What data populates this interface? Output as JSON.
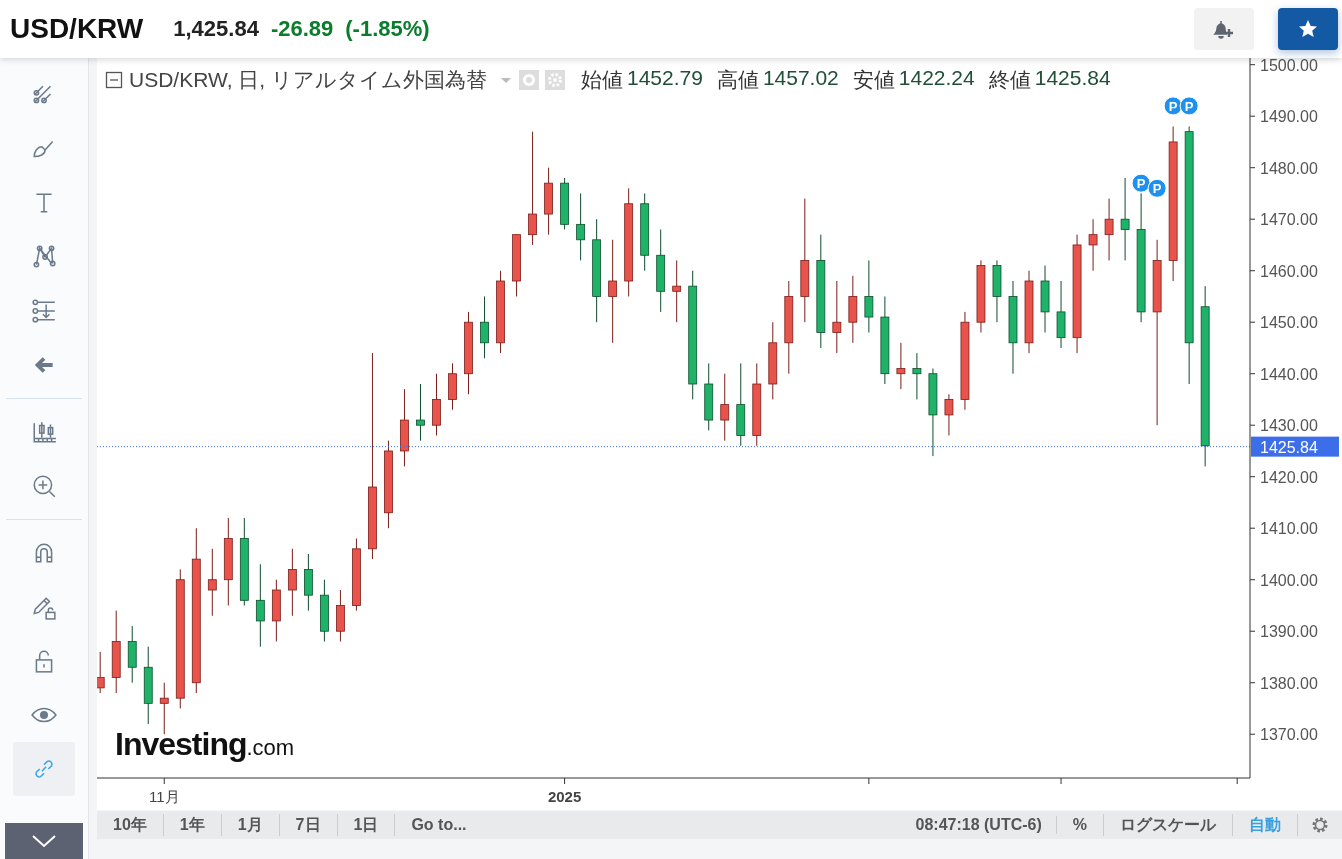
{
  "header": {
    "symbol": "USD/KRW",
    "price": "1,425.84",
    "change": "-26.89",
    "change_percent": "(-1.85%)",
    "favorite": true
  },
  "legend": {
    "title": "USD/KRW, 日, リアルタイム外国為替",
    "ohlc": [
      {
        "label": "始値",
        "value": "1452.79"
      },
      {
        "label": "高値",
        "value": "1457.02"
      },
      {
        "label": "安値",
        "value": "1422.24"
      },
      {
        "label": "終値",
        "value": "1425.84"
      }
    ]
  },
  "toolbar": [
    {
      "kind": "lines"
    },
    {
      "kind": "brush"
    },
    {
      "kind": "text"
    },
    {
      "kind": "pattern"
    },
    {
      "kind": "measure"
    },
    {
      "kind": "back"
    },
    {
      "kind": "divider"
    },
    {
      "kind": "candles"
    },
    {
      "kind": "zoom"
    },
    {
      "kind": "divider"
    },
    {
      "kind": "magnet"
    },
    {
      "kind": "pencil-lock"
    },
    {
      "kind": "lock"
    },
    {
      "kind": "eye"
    },
    {
      "kind": "link",
      "selected": true
    }
  ],
  "chart": {
    "watermark_main": "Investing",
    "watermark_suffix": ".com",
    "last_price": "1425.84",
    "markers": [
      {
        "text": "P"
      },
      {
        "text": "P"
      },
      {
        "text": "P"
      },
      {
        "text": "P"
      }
    ],
    "chart_data": {
      "type": "candlestick",
      "ylim": [
        1361.5,
        1501.3
      ],
      "categories": [
        null,
        null,
        null,
        null,
        "11月",
        null,
        null,
        null,
        null,
        null,
        null,
        null,
        null,
        null,
        null,
        null,
        null,
        null,
        null,
        null,
        null,
        null,
        null,
        null,
        null,
        null,
        null,
        null,
        null,
        "2025",
        null,
        null,
        null,
        null,
        null,
        null,
        null,
        null,
        null,
        null,
        null,
        null,
        null,
        null,
        null,
        null,
        null,
        null,
        null,
        null,
        null,
        null,
        null,
        null,
        null,
        null,
        null,
        null,
        null,
        null,
        null,
        null,
        null,
        null,
        null,
        null,
        null,
        null,
        null,
        null
      ],
      "yticks": [
        {
          "value": 1370,
          "label": "1370.00"
        },
        {
          "value": 1380,
          "label": "1380.00"
        },
        {
          "value": 1390,
          "label": "1390.00"
        },
        {
          "value": 1400,
          "label": "1400.00"
        },
        {
          "value": 1410,
          "label": "1410.00"
        },
        {
          "value": 1420,
          "label": "1420.00"
        },
        {
          "value": 1430,
          "label": "1430.00"
        },
        {
          "value": 1440,
          "label": "1440.00"
        },
        {
          "value": 1450,
          "label": "1450.00"
        },
        {
          "value": 1460,
          "label": "1460.00"
        },
        {
          "value": 1470,
          "label": "1470.00"
        },
        {
          "value": 1480,
          "label": "1480.00"
        },
        {
          "value": 1490,
          "label": "1490.00"
        },
        {
          "value": 1500,
          "label": "1500.00"
        }
      ],
      "ref_lines": [
        {
          "axis": "y",
          "value": 1425.84
        }
      ],
      "ohlc": [
        [
          1379,
          1386,
          1378,
          1381
        ],
        [
          1381,
          1394,
          1378,
          1388
        ],
        [
          1388,
          1391,
          1380,
          1383
        ],
        [
          1383,
          1387,
          1372,
          1376
        ],
        [
          1376,
          1380,
          1370,
          1377
        ],
        [
          1377,
          1402,
          1375,
          1400
        ],
        [
          1380,
          1410,
          1378,
          1404
        ],
        [
          1398,
          1406,
          1393,
          1400
        ],
        [
          1400,
          1412,
          1395,
          1408
        ],
        [
          1408,
          1412,
          1395,
          1396
        ],
        [
          1396,
          1403,
          1387,
          1392
        ],
        [
          1392,
          1400,
          1388,
          1398
        ],
        [
          1398,
          1406,
          1393,
          1402
        ],
        [
          1402,
          1405,
          1394,
          1397
        ],
        [
          1397,
          1400,
          1388,
          1390
        ],
        [
          1390,
          1398,
          1388,
          1395
        ],
        [
          1395,
          1408,
          1394,
          1406
        ],
        [
          1406,
          1444,
          1404,
          1418
        ],
        [
          1413,
          1427,
          1410,
          1425
        ],
        [
          1425,
          1437,
          1422,
          1431
        ],
        [
          1431,
          1438,
          1427,
          1430
        ],
        [
          1430,
          1440,
          1428,
          1435
        ],
        [
          1435,
          1442,
          1433,
          1440
        ],
        [
          1440,
          1452,
          1436,
          1450
        ],
        [
          1450,
          1455,
          1443,
          1446
        ],
        [
          1446,
          1460,
          1444,
          1458
        ],
        [
          1458,
          1467,
          1455,
          1467
        ],
        [
          1467,
          1487,
          1465,
          1471
        ],
        [
          1471,
          1480,
          1467,
          1477
        ],
        [
          1477,
          1478,
          1468,
          1469
        ],
        [
          1469,
          1475,
          1462,
          1466
        ],
        [
          1466,
          1470,
          1450,
          1455
        ],
        [
          1455,
          1466,
          1446,
          1458
        ],
        [
          1458,
          1476,
          1455,
          1473
        ],
        [
          1473,
          1475,
          1460,
          1463
        ],
        [
          1463,
          1468,
          1452,
          1456
        ],
        [
          1456,
          1462,
          1450,
          1457
        ],
        [
          1457,
          1460,
          1435,
          1438
        ],
        [
          1438,
          1442,
          1429,
          1431
        ],
        [
          1431,
          1440,
          1427,
          1434
        ],
        [
          1434,
          1442,
          1426,
          1428
        ],
        [
          1428,
          1442,
          1426,
          1438
        ],
        [
          1438,
          1450,
          1435,
          1446
        ],
        [
          1446,
          1458,
          1440,
          1455
        ],
        [
          1455,
          1474,
          1450,
          1462
        ],
        [
          1462,
          1467,
          1445,
          1448
        ],
        [
          1448,
          1458,
          1444,
          1450
        ],
        [
          1450,
          1459,
          1446,
          1455
        ],
        [
          1455,
          1462,
          1448,
          1451
        ],
        [
          1451,
          1455,
          1438,
          1440
        ],
        [
          1440,
          1446,
          1437,
          1441
        ],
        [
          1441,
          1444,
          1435,
          1440
        ],
        [
          1440,
          1441,
          1424,
          1432
        ],
        [
          1432,
          1436,
          1428,
          1435
        ],
        [
          1435,
          1452,
          1433,
          1450
        ],
        [
          1450,
          1462,
          1448,
          1461
        ],
        [
          1461,
          1462,
          1450,
          1455
        ],
        [
          1455,
          1458,
          1440,
          1446
        ],
        [
          1446,
          1460,
          1444,
          1458
        ],
        [
          1458,
          1461,
          1448,
          1452
        ],
        [
          1452,
          1458,
          1445,
          1447
        ],
        [
          1447,
          1467,
          1444,
          1465
        ],
        [
          1465,
          1470,
          1460,
          1467
        ],
        [
          1467,
          1474,
          1462,
          1470
        ],
        [
          1470,
          1478,
          1462,
          1468
        ],
        [
          1468,
          1475,
          1450,
          1452
        ],
        [
          1452,
          1466,
          1430,
          1462
        ],
        [
          1462,
          1488,
          1458,
          1485
        ],
        [
          1487,
          1488,
          1438,
          1446
        ],
        [
          1453,
          1457,
          1422,
          1426
        ]
      ]
    }
  },
  "bottom_bar": {
    "ranges": [
      {
        "label": "10年"
      },
      {
        "label": "1年"
      },
      {
        "label": "1月"
      },
      {
        "label": "7日"
      },
      {
        "label": "1日"
      },
      {
        "label": "Go to..."
      }
    ],
    "time": "08:47:18 (UTC-6)",
    "options": [
      {
        "label": "%",
        "selected": false
      },
      {
        "label": "ログスケール",
        "selected": false
      },
      {
        "label": "自動",
        "selected": true
      }
    ]
  }
}
